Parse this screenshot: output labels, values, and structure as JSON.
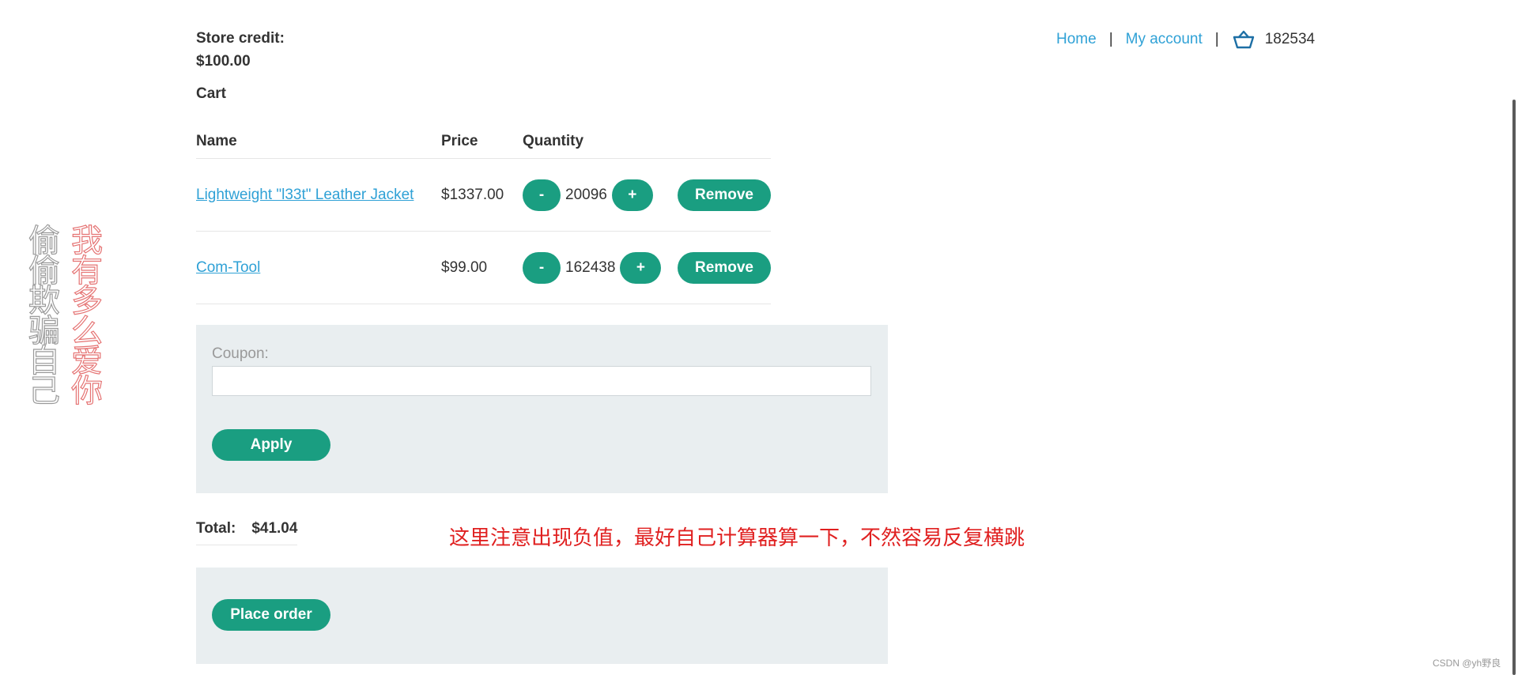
{
  "account": {
    "store_credit_label": "Store credit:",
    "store_credit_value": "$100.00",
    "cart_heading": "Cart"
  },
  "nav": {
    "home": "Home",
    "separator": "|",
    "my_account": "My account",
    "cart_icon": "cart-icon",
    "cart_count": "182534"
  },
  "cart": {
    "headers": {
      "name": "Name",
      "price": "Price",
      "quantity": "Quantity"
    },
    "items": [
      {
        "name": "Lightweight \"l33t\" Leather Jacket",
        "price": "$1337.00",
        "quantity": "20096",
        "minus": "-",
        "plus": "+",
        "remove": "Remove"
      },
      {
        "name": "Com-Tool",
        "price": "$99.00",
        "quantity": "162438",
        "minus": "-",
        "plus": "+",
        "remove": "Remove"
      }
    ]
  },
  "coupon": {
    "label": "Coupon:",
    "value": "",
    "apply_label": "Apply"
  },
  "totals": {
    "label": "Total:",
    "value": "$41.04"
  },
  "order": {
    "place_order_label": "Place order"
  },
  "overlay": {
    "annotation": "这里注意出现负值，最好自己计算器算一下，不然容易反复横跳",
    "vertical_gray": "偷偷欺骗自己",
    "vertical_red": "我有多么爱你",
    "watermark": "CSDN @yh野良"
  },
  "colors": {
    "link": "#2fa1d6",
    "button": "#1a9e81",
    "panel": "#e9eef0",
    "annotation": "#e02020"
  }
}
